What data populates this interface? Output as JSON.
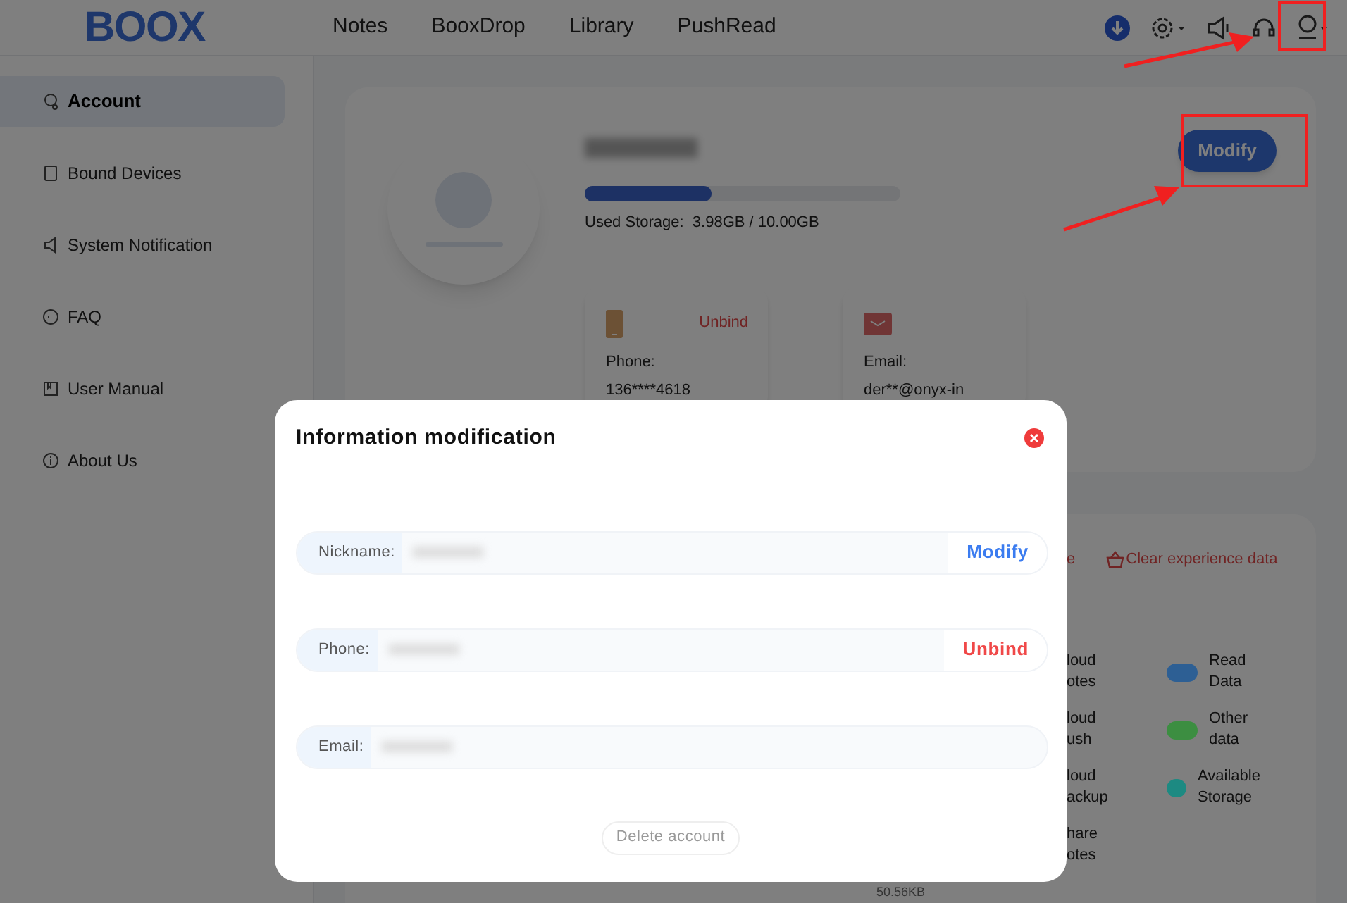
{
  "header": {
    "logo": "BOOX",
    "nav": [
      {
        "label": "Notes",
        "selected": false
      },
      {
        "label": "BooxDrop",
        "selected": false
      },
      {
        "label": "Library",
        "selected": false
      },
      {
        "label": "PushRead",
        "selected": false
      }
    ]
  },
  "sidebar": {
    "items": [
      {
        "label": "Account",
        "kind": "account",
        "selected": true
      },
      {
        "label": "Bound Devices",
        "kind": "device",
        "selected": false
      },
      {
        "label": "System Notification",
        "kind": "speaker",
        "selected": false
      },
      {
        "label": "FAQ",
        "kind": "chat",
        "selected": false
      },
      {
        "label": "User Manual",
        "kind": "book",
        "selected": false
      },
      {
        "label": "About Us",
        "kind": "info",
        "selected": false
      }
    ]
  },
  "profile": {
    "storage": {
      "level": 0.4,
      "label": "Used Storage:",
      "value": "3.98GB / 10.00GB"
    },
    "modify_button": "Modify",
    "contacts": [
      {
        "kind": "phone",
        "label": "Phone:",
        "value": "136****4618",
        "action": "Unbind"
      },
      {
        "kind": "email",
        "label": "Email:",
        "value": "der**@onyx-in"
      }
    ]
  },
  "data_card": {
    "link_fragment": "e",
    "clear_link": "Clear experience data",
    "legend_left": [
      {
        "lines": [
          "loud",
          "otes"
        ]
      },
      {
        "lines": [
          "loud",
          "ush"
        ]
      },
      {
        "lines": [
          "loud",
          "ackup"
        ]
      },
      {
        "lines": [
          "hare",
          "otes"
        ]
      }
    ],
    "legend_right": [
      {
        "label": [
          "Read",
          "Data"
        ],
        "color": "#2d5f94"
      },
      {
        "label": [
          "Other",
          "data"
        ],
        "color": "#3c8e41"
      },
      {
        "label": [
          "Available",
          "Storage"
        ],
        "color": "#1d8a82"
      }
    ],
    "size_fragment": "50.56KB"
  },
  "dialog": {
    "title": "Information modification",
    "fields": [
      {
        "label": "Nickname:",
        "action": "Modify",
        "kind": "modify"
      },
      {
        "label": "Phone:",
        "action": "Unbind",
        "kind": "unbind"
      },
      {
        "label": "Email:"
      }
    ],
    "delete_button": "Delete account"
  }
}
